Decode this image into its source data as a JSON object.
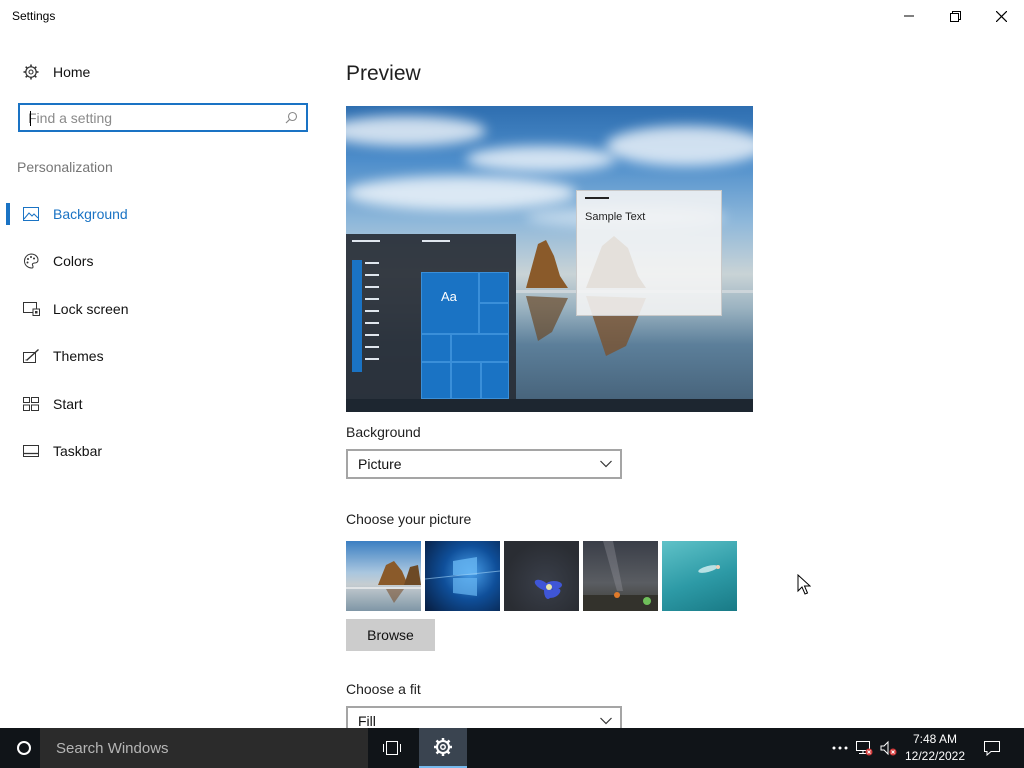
{
  "window": {
    "title": "Settings"
  },
  "sidebar": {
    "home_label": "Home",
    "search_placeholder": "Find a setting",
    "section_title": "Personalization",
    "items": [
      {
        "label": "Background",
        "icon": "picture-icon",
        "selected": true
      },
      {
        "label": "Colors",
        "icon": "palette-icon",
        "selected": false
      },
      {
        "label": "Lock screen",
        "icon": "lock-screen-icon",
        "selected": false
      },
      {
        "label": "Themes",
        "icon": "themes-icon",
        "selected": false
      },
      {
        "label": "Start",
        "icon": "start-icon",
        "selected": false
      },
      {
        "label": "Taskbar",
        "icon": "taskbar-icon",
        "selected": false
      }
    ]
  },
  "main": {
    "preview_heading": "Preview",
    "preview_sample_text": "Sample Text",
    "preview_tile_text": "Aa",
    "background_label": "Background",
    "background_value": "Picture",
    "choose_picture_label": "Choose your picture",
    "pictures": [
      "beach-rocks",
      "windows-logo",
      "blue-flower",
      "night-sky",
      "underwater-swimmer"
    ],
    "browse_label": "Browse",
    "fit_label": "Choose a fit",
    "fit_value": "Fill"
  },
  "taskbar": {
    "search_text": "Search Windows",
    "time": "7:48 AM",
    "date": "12/22/2022"
  },
  "colors": {
    "accent": "#1a73c4",
    "taskbar": "#101418"
  }
}
